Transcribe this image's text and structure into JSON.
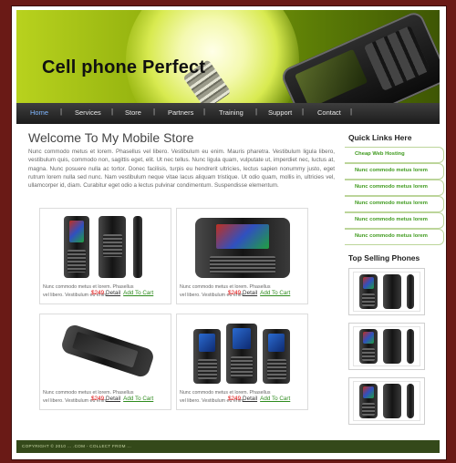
{
  "site": {
    "title": "Cell phone Perfect"
  },
  "nav": [
    {
      "label": "Home",
      "active": true
    },
    {
      "label": "Services"
    },
    {
      "label": "Store"
    },
    {
      "label": "Partners"
    },
    {
      "label": "Training"
    },
    {
      "label": "Support"
    },
    {
      "label": "Contact"
    }
  ],
  "main": {
    "heading": "Welcome To My Mobile Store",
    "intro": "Nunc commodo metus et lorem. Phasellus vel libero. Vestibulum eu enim. Mauris pharetra. Vestibulum ligula libero, vestibulum quis, commodo non, sagittis eget, elit. Ut nec tellus. Nunc ligula quam, vulputate ut, imperdiet nec, luctus at, magna. Nunc posuere nulla ac tortor. Donec facilisis, turpis eu hendrerit ultricies, lectus sapien nonummy justo, eget rutrum lorem nulla sed nunc. Nam vestibulum neque vitae lacus aliquam tristique. Ut odio quam, mollis in, ultricies vel, ullamcorper id, diam. Curabitur eget odio a lectus pulvinar condimentum. Suspendisse elementum."
  },
  "products": [
    {
      "desc": "Nunc commodo metus et lorem. Phasellus vel libero. Vestibulum eu enim...",
      "price": "$249",
      "details": "Detail",
      "cart": "Add To Cart"
    },
    {
      "desc": "Nunc commodo metus et lorem. Phasellus vel libero. Vestibulum eu enim...",
      "price": "$249",
      "details": "Detail",
      "cart": "Add To Cart"
    },
    {
      "desc": "Nunc commodo metus et lorem. Phasellus vel libero. Vestibulum eu enim...",
      "price": "$249",
      "details": "Detail",
      "cart": "Add To Cart"
    },
    {
      "desc": "Nunc commodo metus et lorem. Phasellus vel libero. Vestibulum eu enim...",
      "price": "$249",
      "details": "Detail",
      "cart": "Add To Cart"
    }
  ],
  "sidebar": {
    "quick_title": "Quick Links Here",
    "quick_links": [
      "Cheap Web Hosting",
      "Nunc commodo metus lorem",
      "Nunc commodo metus lorem",
      "Nunc commodo metus lorem",
      "Nunc commodo metus lorem",
      "Nunc commodo metus lorem"
    ],
    "top_title": "Top Selling Phones"
  },
  "footer": {
    "text": "COPYRIGHT © 2010 ... .COM - COLLECT FROM ..."
  },
  "colors": {
    "header_green": "#8fae0d",
    "link_green": "#3f9a1e",
    "price_red": "#dd0000",
    "footer_green": "#34491a",
    "page_bg": "#6a1a16"
  }
}
